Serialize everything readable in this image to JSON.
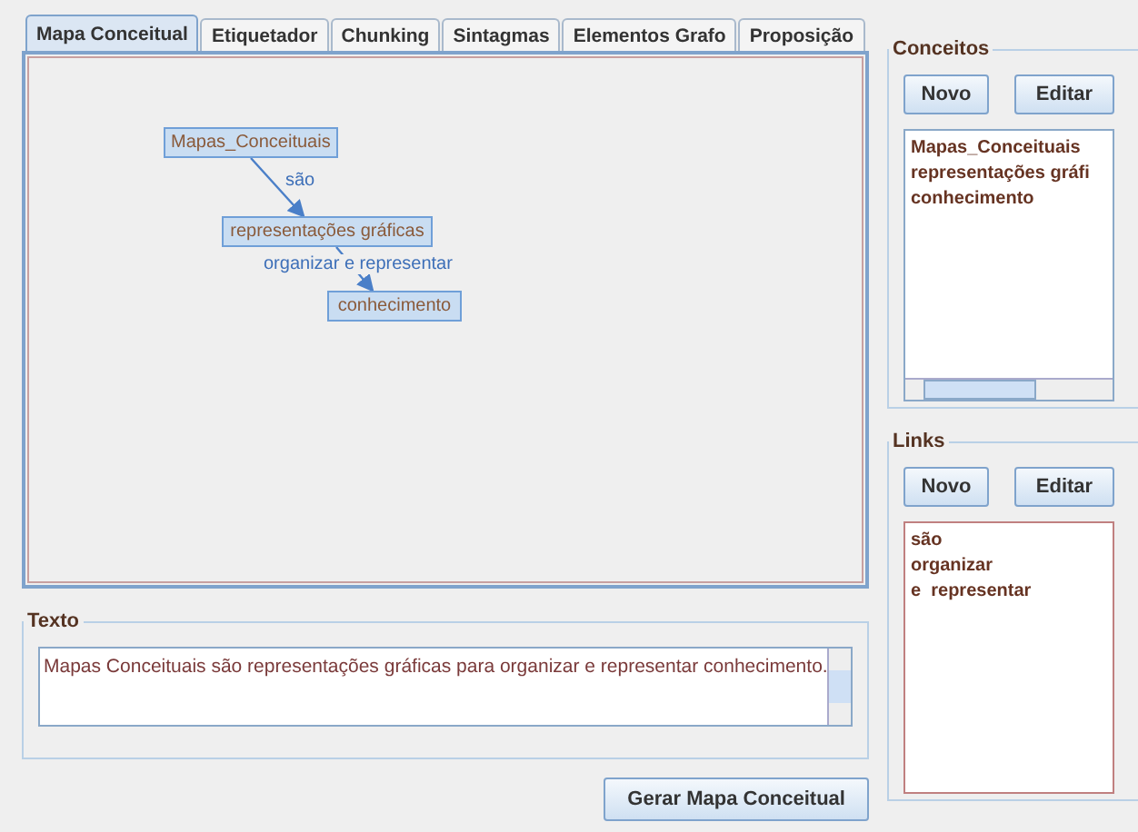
{
  "tabs": [
    {
      "label": "Mapa Conceitual",
      "selected": true
    },
    {
      "label": "Etiquetador",
      "selected": false
    },
    {
      "label": "Chunking",
      "selected": false
    },
    {
      "label": "Sintagmas",
      "selected": false
    },
    {
      "label": "Elementos Grafo",
      "selected": false
    },
    {
      "label": "Proposição",
      "selected": false
    }
  ],
  "concept_map": {
    "nodes": [
      "Mapas_Conceituais",
      "representações gráficas",
      "conhecimento"
    ],
    "links": [
      {
        "label": "são"
      },
      {
        "label": "organizar e representar"
      }
    ]
  },
  "texto": {
    "title": "Texto",
    "value": "Mapas Conceituais são representações gráficas para organizar e representar conhecimento."
  },
  "generate_button": "Gerar Mapa Conceitual",
  "conceitos": {
    "title": "Conceitos",
    "buttons": [
      "Novo",
      "Editar"
    ],
    "items": [
      "Mapas_Conceituais",
      "representações gráfi",
      "conhecimento"
    ]
  },
  "links": {
    "title": "Links",
    "buttons": [
      "Novo",
      "Editar"
    ],
    "items": [
      "são",
      "organizar",
      "e  representar"
    ]
  }
}
